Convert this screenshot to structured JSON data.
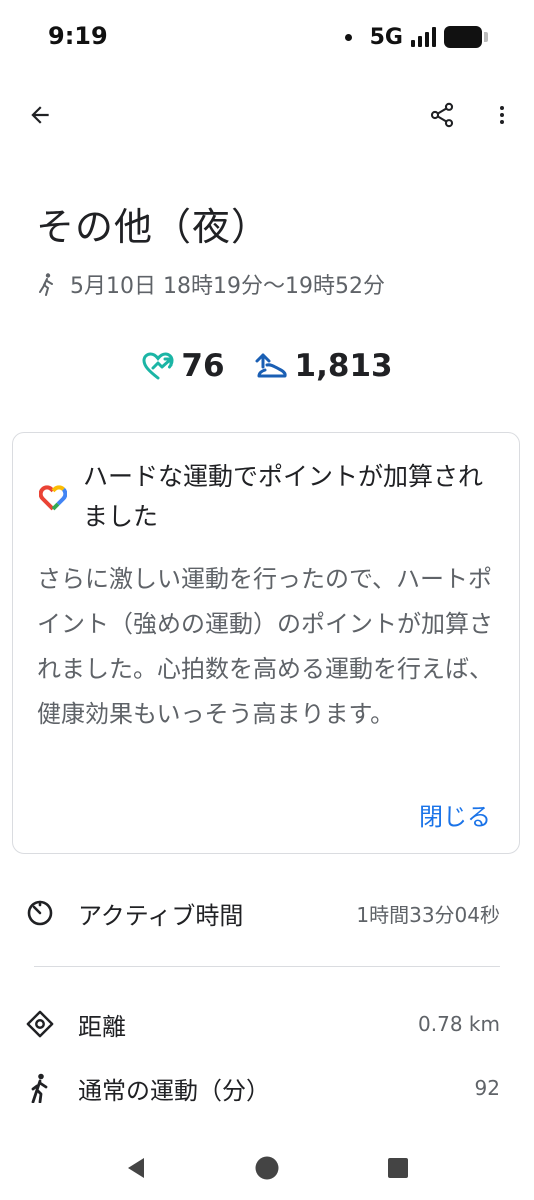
{
  "status_bar": {
    "time": "9:19",
    "network": "5G",
    "icons": [
      "notification-dot-icon",
      "signal-icon",
      "battery-icon"
    ]
  },
  "toolbar": {
    "icons": [
      "back-arrow-icon",
      "share-icon",
      "more-vert-icon"
    ]
  },
  "activity": {
    "title": "その他（夜）",
    "datetime": "5月10日 18時19分〜19時52分",
    "subtitle_icon": "activity-figure-icon"
  },
  "metrics": {
    "heart_points": "76",
    "calories": "1,813",
    "heart_color": "#1bb5a5",
    "calories_color": "#1a5fb4"
  },
  "card": {
    "title": "ハードな運動でポイントが加算されました",
    "body": "さらに激しい運動を行ったので、ハートポイント（強めの運動）のポイントが加算されました。心拍数を高める運動を行えば、健康効果もいっそう高まります。",
    "close_label": "閉じる",
    "logo_icon": "google-fit-heart-logo",
    "accent": "#1a73e8"
  },
  "stats": [
    {
      "icon": "timer-icon",
      "label": "アクティブ時間",
      "value": "1時間33分04秒"
    },
    {
      "icon": "location-diamond-icon",
      "label": "距離",
      "value": "0.78 km"
    },
    {
      "icon": "walking-icon",
      "label": "通常の運動（分）",
      "value": "92"
    }
  ],
  "nav_bar": {
    "icons": [
      "nav-back-icon",
      "nav-home-icon",
      "nav-recents-icon"
    ]
  }
}
